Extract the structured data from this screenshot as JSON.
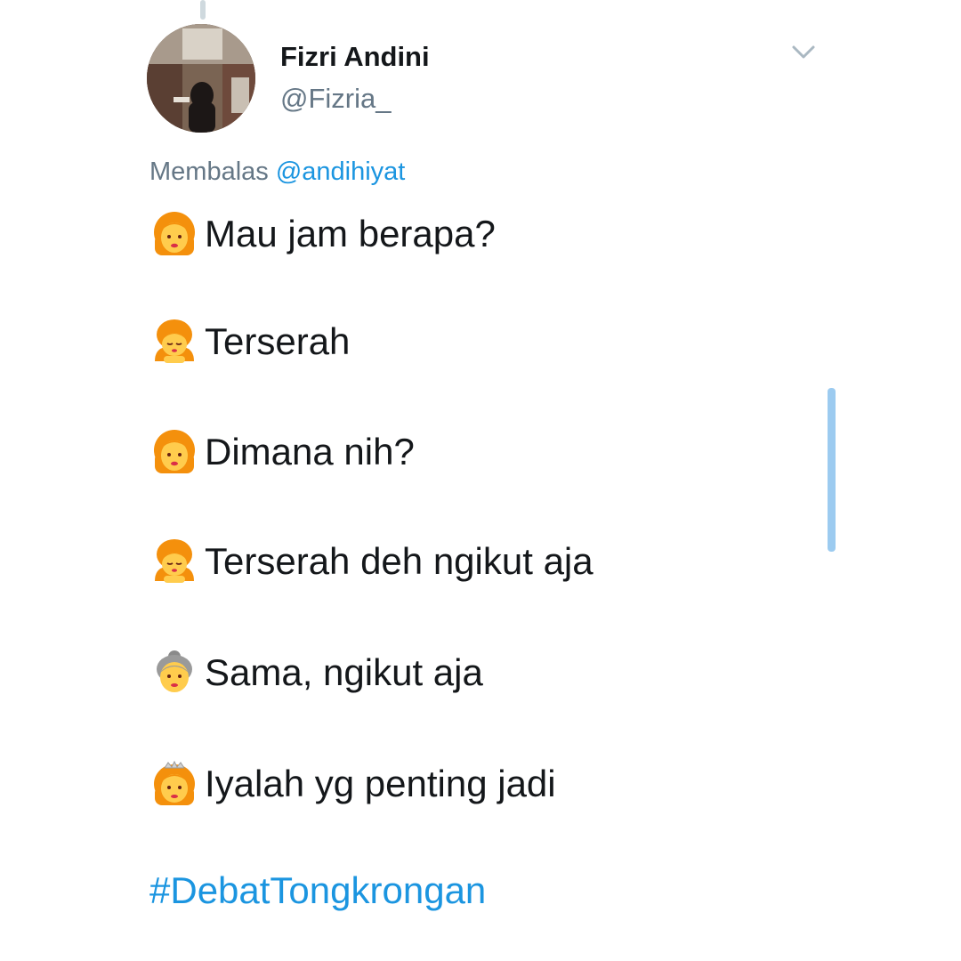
{
  "tweet": {
    "author_name": "Fizri Andini",
    "author_handle": "@Fizria_",
    "reply_prefix": "Membalas ",
    "reply_mention": "@andihiyat",
    "lines": [
      {
        "icon": "woman-orange-hair-emoji",
        "text": "Mau jam berapa?"
      },
      {
        "icon": "woman-bowing-emoji",
        "text": "Terserah"
      },
      {
        "icon": "woman-orange-hair-emoji",
        "text": "Dimana nih?"
      },
      {
        "icon": "woman-bowing-emoji",
        "text": "Terserah deh ngikut aja"
      },
      {
        "icon": "old-woman-emoji",
        "text": "Sama, ngikut aja"
      },
      {
        "icon": "princess-emoji",
        "text": "Iyalah yg penting jadi"
      }
    ],
    "hashtag": "#DebatTongkrongan"
  },
  "colors": {
    "text": "#14171a",
    "secondary": "#657786",
    "link": "#1b95e0",
    "scrollbar": "#9ccbf0"
  }
}
